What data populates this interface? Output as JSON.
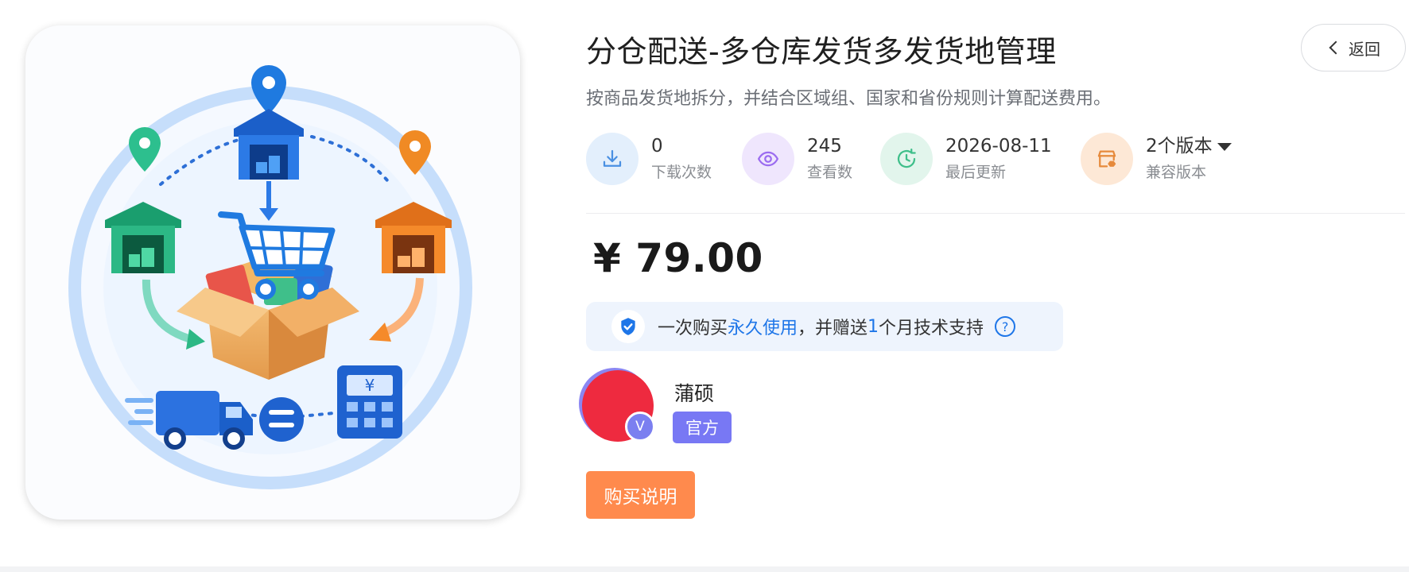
{
  "product": {
    "title": "分仓配送-多仓库发货多发货地管理",
    "subtitle": "按商品发货地拆分，并结合区域组、国家和省份规则计算配送费用。",
    "price": "¥ 79.00"
  },
  "header": {
    "back_label": "返回"
  },
  "stats": [
    {
      "value": "0",
      "label": "下载次数",
      "icon": "download-icon",
      "color": "#4a90e2"
    },
    {
      "value": "245",
      "label": "查看数",
      "icon": "eye-icon",
      "color": "#9b6cf0"
    },
    {
      "value": "2026-08-11",
      "label": "最后更新",
      "icon": "clock-icon",
      "color": "#3fbf8a"
    },
    {
      "value": "2个版本",
      "label": "兼容版本",
      "icon": "store-icon",
      "color": "#e68a3c"
    }
  ],
  "promo": {
    "prefix": "一次购买",
    "highlight": "永久使用",
    "middle": "，并赠送",
    "months": "1",
    "suffix": "个月技术支持",
    "help": "?"
  },
  "author": {
    "name": "蒲硕",
    "badge": "V",
    "tag": "官方"
  },
  "buy_label": "购买说明",
  "image": {
    "calc_label": "¥"
  }
}
